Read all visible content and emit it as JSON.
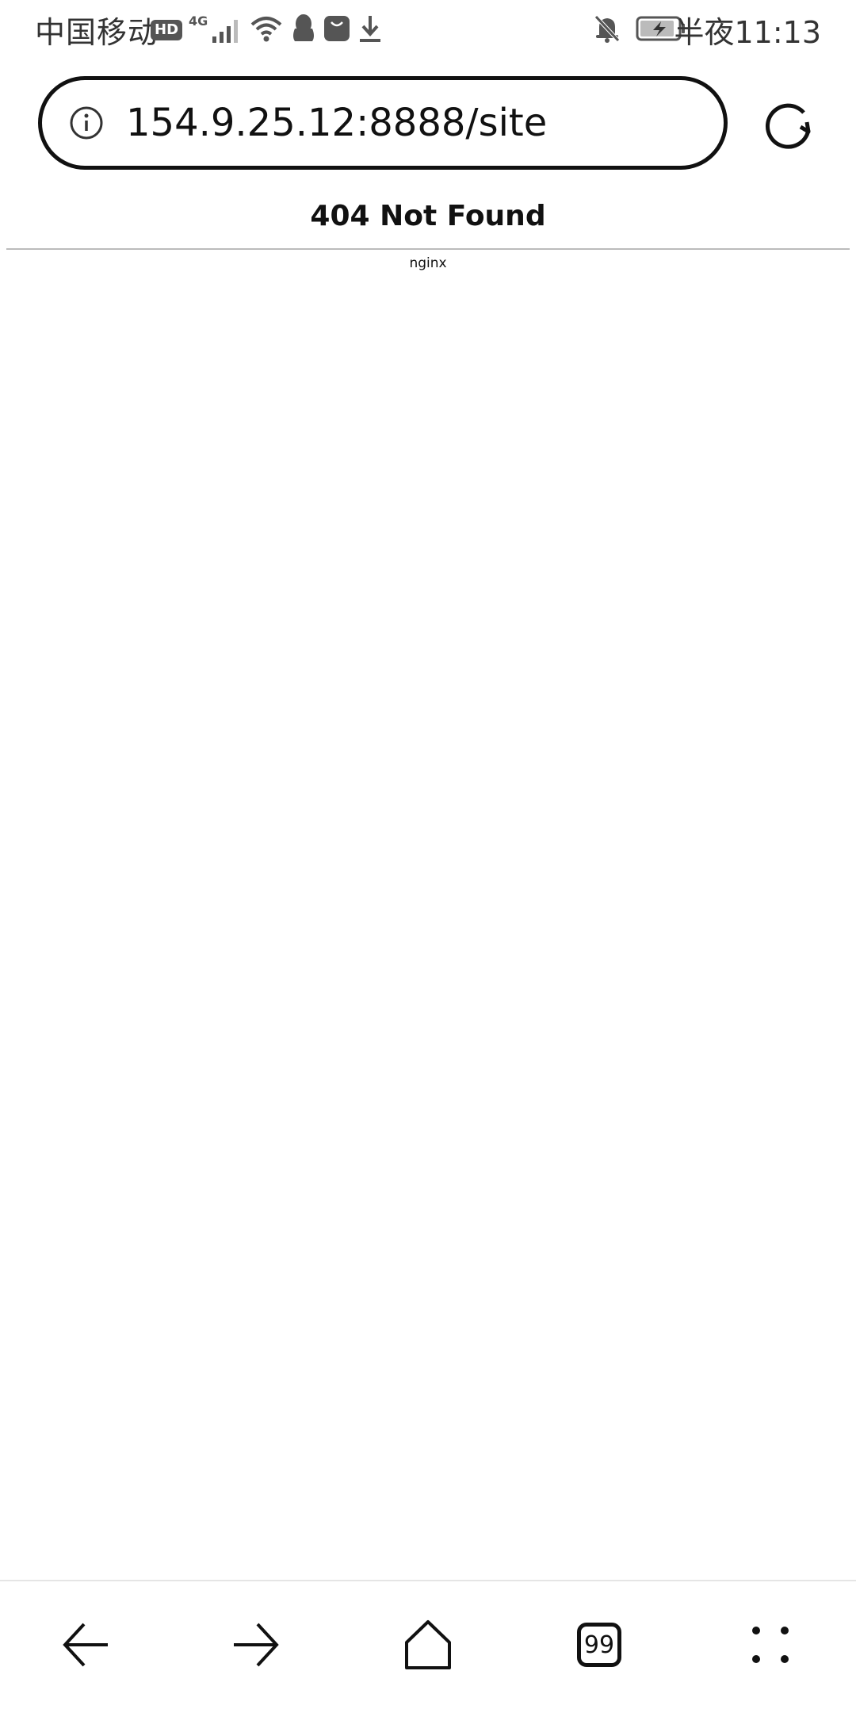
{
  "status_bar": {
    "carrier": "中国移动",
    "hd_label": "HD",
    "network_type": "4G",
    "time": "半夜11:13",
    "icons": [
      "hd-icon",
      "signal-icon",
      "wifi-icon",
      "qq-icon",
      "huawei-store-icon",
      "download-icon",
      "bell-off-icon",
      "battery-charging-icon"
    ]
  },
  "address_bar": {
    "url": "154.9.25.12:8888/site",
    "info_icon": "info-icon",
    "reload_icon": "reload-icon"
  },
  "page": {
    "heading": "404 Not Found",
    "server": "nginx"
  },
  "bottom_nav": {
    "tab_count": "99",
    "items": [
      "back-icon",
      "forward-icon",
      "home-icon",
      "tabs-icon",
      "menu-icon"
    ]
  }
}
